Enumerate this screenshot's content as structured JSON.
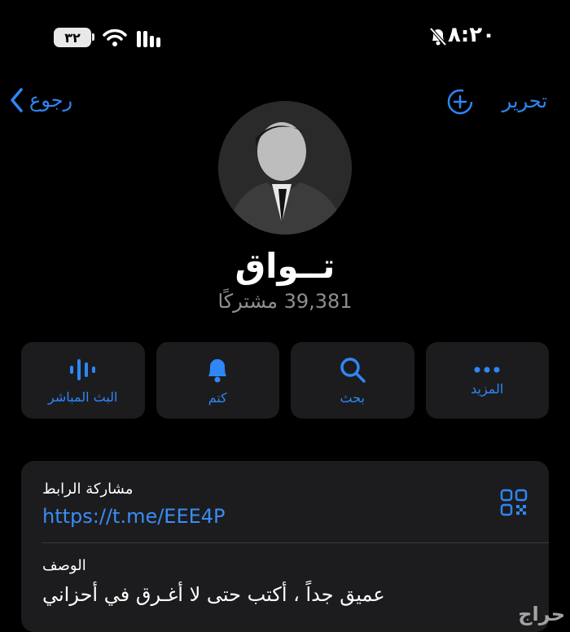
{
  "status_bar": {
    "time": "٨:٢٠",
    "battery": "٣٢"
  },
  "nav": {
    "back_label": "رجوع",
    "edit_label": "تحرير"
  },
  "channel": {
    "name": "تــواق",
    "subscribers": "39,381 مشتركًا"
  },
  "actions": [
    {
      "label": "البث المباشر",
      "icon": "voice-chat-icon"
    },
    {
      "label": "كتم",
      "icon": "bell-icon"
    },
    {
      "label": "بحث",
      "icon": "search-icon"
    },
    {
      "label": "المزيد",
      "icon": "more-icon"
    }
  ],
  "info": {
    "link_label": "مشاركة الرابط",
    "link_value": "https://t.me/EEE4P",
    "description_label": "الوصف",
    "description_value": "عميق جداً ، أكتب حتى لا أغـرق في أحزاني"
  },
  "watermark": "حراج",
  "colors": {
    "accent": "#2e87f7",
    "card": "#1c1c1e",
    "background": "#000000",
    "secondary_text": "#8e8e93"
  }
}
